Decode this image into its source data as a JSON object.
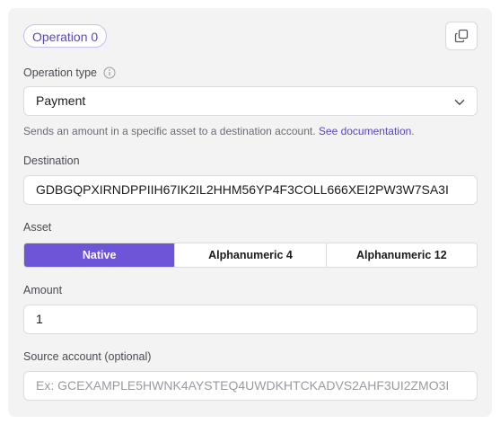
{
  "operation": {
    "badge_label": "Operation 0"
  },
  "operation_type": {
    "label": "Operation type",
    "value": "Payment",
    "description": "Sends an amount in a specific asset to a destination account.",
    "doc_link": "See documentation",
    "trailing": "."
  },
  "destination": {
    "label": "Destination",
    "value": "GDBGQPXIRNDPPIIH67IK2IL2HHM56YP4F3COLL666XEI2PW3W7SA3I"
  },
  "asset": {
    "label": "Asset",
    "options": [
      "Native",
      "Alphanumeric 4",
      "Alphanumeric 12"
    ],
    "selected": "Native"
  },
  "amount": {
    "label": "Amount",
    "value": "1"
  },
  "source_account": {
    "label": "Source account (optional)",
    "placeholder": "Ex: GCEXAMPLE5HWNK4AYSTEQ4UWDKHTCKADVS2AHF3UI2ZMO3I"
  },
  "icons": {
    "copy": "copy-icon",
    "info": "info-icon",
    "chevron": "chevron-down-icon"
  },
  "colors": {
    "accent": "#6e55d8",
    "link": "#5b45c6",
    "card_bg": "#f3f3f4"
  }
}
